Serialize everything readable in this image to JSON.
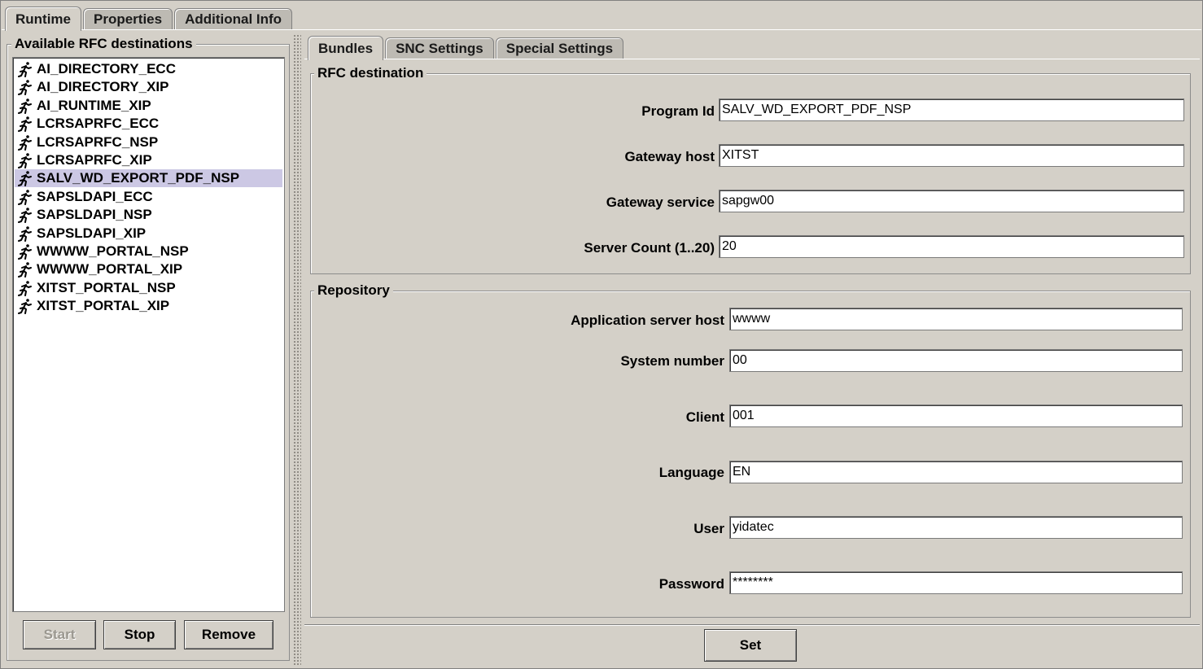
{
  "top_tabs": [
    "Runtime",
    "Properties",
    "Additional Info"
  ],
  "left_panel": {
    "title": "Available RFC destinations",
    "items": [
      "AI_DIRECTORY_ECC",
      "AI_DIRECTORY_XIP",
      "AI_RUNTIME_XIP",
      "LCRSAPRFC_ECC",
      "LCRSAPRFC_NSP",
      "LCRSAPRFC_XIP",
      "SALV_WD_EXPORT_PDF_NSP",
      "SAPSLDAPI_ECC",
      "SAPSLDAPI_NSP",
      "SAPSLDAPI_XIP",
      "WWWW_PORTAL_NSP",
      "WWWW_PORTAL_XIP",
      "XITST_PORTAL_NSP",
      "XITST_PORTAL_XIP"
    ],
    "selected_index": 6,
    "buttons": {
      "start": "Start",
      "stop": "Stop",
      "remove": "Remove"
    }
  },
  "right_tabs": [
    "Bundles",
    "SNC Settings",
    "Special Settings"
  ],
  "rfc_destination": {
    "title": "RFC destination",
    "program_id_label": "Program Id",
    "program_id": "SALV_WD_EXPORT_PDF_NSP",
    "gateway_host_label": "Gateway host",
    "gateway_host": "XITST",
    "gateway_service_label": "Gateway service",
    "gateway_service": "sapgw00",
    "server_count_label": "Server Count (1..20)",
    "server_count": "20"
  },
  "repository": {
    "title": "Repository",
    "app_server_host_label": "Application server host",
    "app_server_host": "wwww",
    "system_number_label": "System number",
    "system_number": "00",
    "client_label": "Client",
    "client": "001",
    "language_label": "Language",
    "language": "EN",
    "user_label": "User",
    "user": "yidatec",
    "password_label": "Password",
    "password": "********"
  },
  "set_button": "Set",
  "colors": {
    "background": "#d4d0c8",
    "selection": "#ccc8e4",
    "field": "#ffffff"
  }
}
